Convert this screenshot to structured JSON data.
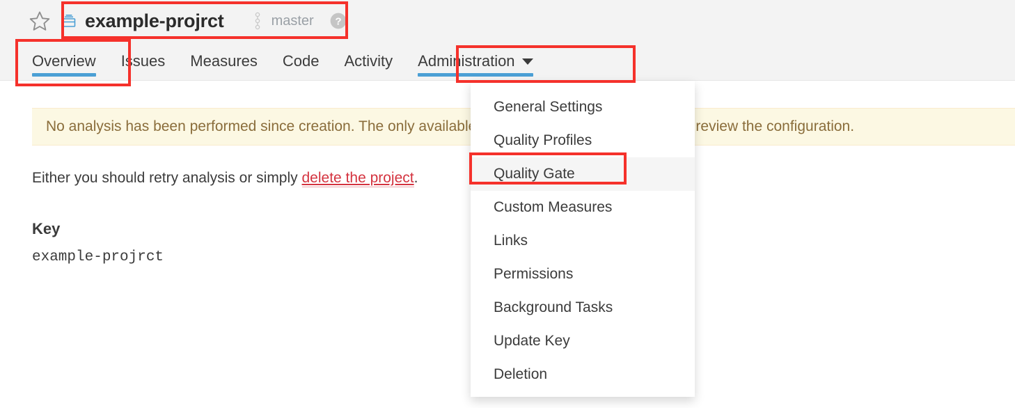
{
  "header": {
    "favorite_icon": "star-icon",
    "project_icon": "project-drawer-icon",
    "project_name": "example-projrct",
    "branch_icon": "branch-icon",
    "branch_name": "master",
    "help_icon": "help-circle-icon"
  },
  "tabs": [
    {
      "label": "Overview",
      "active": true,
      "has_caret": false
    },
    {
      "label": "Issues",
      "active": false,
      "has_caret": false
    },
    {
      "label": "Measures",
      "active": false,
      "has_caret": false
    },
    {
      "label": "Code",
      "active": false,
      "has_caret": false
    },
    {
      "label": "Activity",
      "active": false,
      "has_caret": false
    },
    {
      "label": "Administration",
      "active": true,
      "has_caret": true
    }
  ],
  "banner": {
    "text": "No analysis has been performed since creation. The only available actions are to retry analysis or to review the configuration."
  },
  "body": {
    "retry_prefix": "Either you should retry analysis or simply ",
    "delete_link": "delete the project",
    "retry_suffix": ".",
    "key_label": "Key",
    "key_value": "example-projrct"
  },
  "dropdown": {
    "items": [
      {
        "label": "General Settings",
        "hovered": false
      },
      {
        "label": "Quality Profiles",
        "hovered": false
      },
      {
        "label": "Quality Gate",
        "hovered": true
      },
      {
        "label": "Custom Measures",
        "hovered": false
      },
      {
        "label": "Links",
        "hovered": false
      },
      {
        "label": "Permissions",
        "hovered": false
      },
      {
        "label": "Background Tasks",
        "hovered": false
      },
      {
        "label": "Update Key",
        "hovered": false
      },
      {
        "label": "Deletion",
        "hovered": false
      }
    ]
  },
  "annotations": {
    "color": "#f5312b",
    "boxes": [
      {
        "name": "project-title-highlight"
      },
      {
        "name": "overview-tab-highlight"
      },
      {
        "name": "administration-tab-highlight"
      },
      {
        "name": "quality-gate-item-highlight"
      }
    ]
  },
  "colors": {
    "accent_blue": "#4b9fd5",
    "header_bg": "#f3f3f3",
    "banner_bg": "#fcf8e3",
    "banner_text": "#8a6d3b",
    "link_red": "#d4333f",
    "annotation_red": "#f5312b"
  }
}
